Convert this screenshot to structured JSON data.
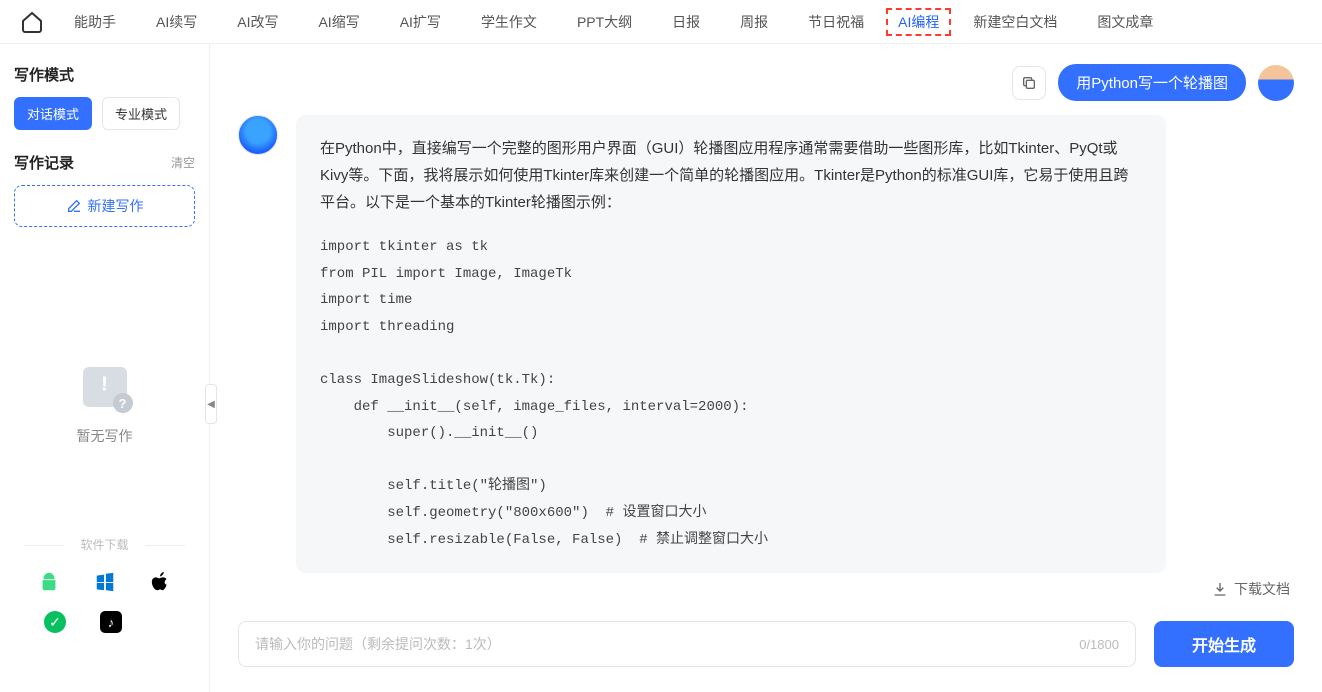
{
  "nav": {
    "items": [
      "能助手",
      "AI续写",
      "AI改写",
      "AI缩写",
      "AI扩写",
      "学生作文",
      "PPT大纲",
      "日报",
      "周报",
      "节日祝福",
      "AI编程",
      "新建空白文档",
      "图文成章"
    ],
    "activeIndex": 10
  },
  "sidebar": {
    "modeTitle": "写作模式",
    "modes": [
      "对话模式",
      "专业模式"
    ],
    "recordTitle": "写作记录",
    "clear": "清空",
    "newWrite": "新建写作",
    "emptyText": "暂无写作",
    "downloadTitle": "软件下载"
  },
  "chat": {
    "userMessage": "用Python写一个轮播图",
    "botText": "在Python中，直接编写一个完整的图形用户界面（GUI）轮播图应用程序通常需要借助一些图形库，比如Tkinter、PyQt或Kivy等。下面，我将展示如何使用Tkinter库来创建一个简单的轮播图应用。Tkinter是Python的标准GUI库，它易于使用且跨平台。以下是一个基本的Tkinter轮播图示例：",
    "code": "import tkinter as tk\nfrom PIL import Image, ImageTk\nimport time\nimport threading\n\nclass ImageSlideshow(tk.Tk):\n    def __init__(self, image_files, interval=2000):\n        super().__init__()\n\n        self.title(\"轮播图\")\n        self.geometry(\"800x600\")  # 设置窗口大小\n        self.resizable(False, False)  # 禁止调整窗口大小"
  },
  "downloadDoc": "下载文档",
  "input": {
    "placeholder": "请输入你的问题（剩余提问次数：1次）",
    "counter": "0/1800",
    "button": "开始生成"
  }
}
